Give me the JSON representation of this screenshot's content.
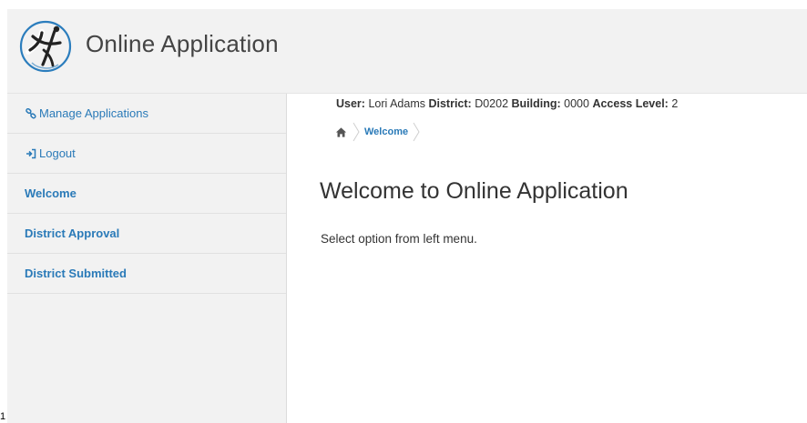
{
  "header": {
    "app_title": "Online Application",
    "logo_icon": "person-circle-logo-icon"
  },
  "sidebar": {
    "items": [
      {
        "label": "Manage Applications",
        "icon": "link-icon",
        "bold": false
      },
      {
        "label": "Logout",
        "icon": "logout-icon",
        "bold": false
      },
      {
        "label": "Welcome",
        "icon": "",
        "bold": true
      },
      {
        "label": "District Approval",
        "icon": "",
        "bold": true
      },
      {
        "label": "District Submitted",
        "icon": "",
        "bold": true
      }
    ]
  },
  "user_info": {
    "user_label": "User:",
    "user_value": "Lori Adams",
    "district_label": "District:",
    "district_value": "D0202",
    "building_label": "Building:",
    "building_value": "0000",
    "access_label": "Access Level:",
    "access_value": "2"
  },
  "breadcrumb": {
    "home_icon": "home-icon",
    "current": "Welcome"
  },
  "main": {
    "title": "Welcome to Online Application",
    "subtitle": "Select option from left menu."
  },
  "corner_mark": "1",
  "colors": {
    "link": "#2a7ab8",
    "header_bg": "#f2f2f2",
    "sidebar_bg": "#f2f2f2"
  }
}
